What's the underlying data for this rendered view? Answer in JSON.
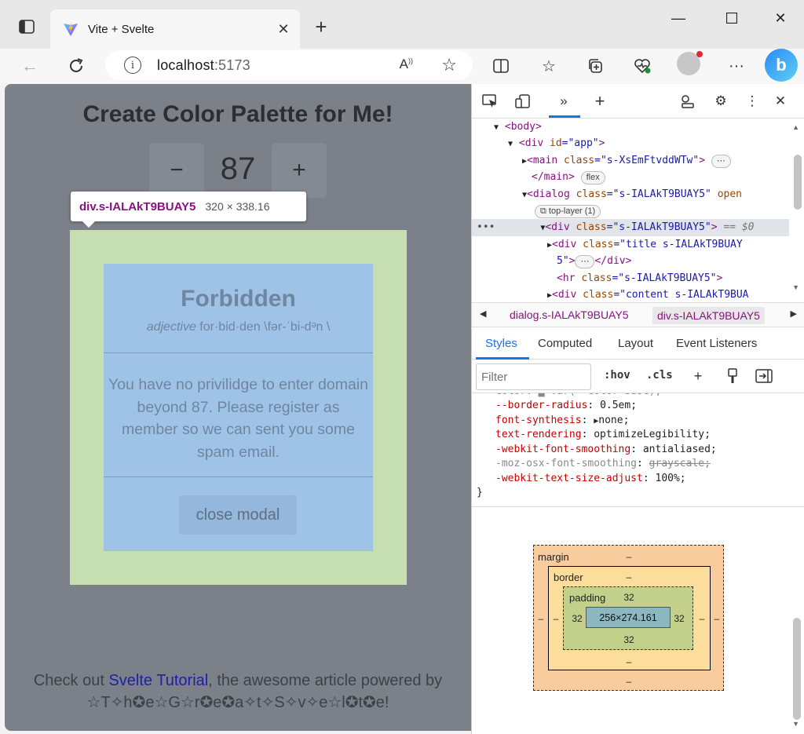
{
  "browser": {
    "tab_title": "Vite + Svelte",
    "url_host": "localhost",
    "url_port": ":5173"
  },
  "page": {
    "title": "Create Color Palette for Me!",
    "minus_label": "−",
    "counter_value": "87",
    "plus_label": "+",
    "inspect_tooltip": {
      "selector": "div.s-IALAkT9BUAY5",
      "dimensions": "320 × 338.16"
    },
    "modal": {
      "word": "Forbidden",
      "part_of_speech": "adjective",
      "pronunciation": "for·bid·den \\fər-ˈbi-dᵊn \\",
      "message": "You have no privilidge to enter domain beyond 87. Please register as member so we can sent you some spam email.",
      "close_label": "close modal"
    },
    "footer": {
      "prefix": "Check out ",
      "link": "Svelte Tutorial",
      "suffix": ", the awesome article powered by",
      "signature": "☆T✧h✪e☆G☆r✪e✪a✧t✧S✧v✧e☆l✪t✪e!"
    }
  },
  "devtools": {
    "dom_lines": [
      {
        "text": "body"
      },
      {
        "text": "div id=\"app\""
      },
      {
        "text": "main class=\"s-XsEmFtvddWTw\""
      },
      {
        "text": "/main"
      },
      {
        "text": "dialog class=\"s-IALAkT9BUAY5\" open"
      },
      {
        "text": "top-layer (1)"
      },
      {
        "text": "div class=\"s-IALAkT9BUAY5\" == $0"
      },
      {
        "text": "div class=\"title s-IALAkT9BUAY5\""
      },
      {
        "text": "hr class=\"s-IALAkT9BUAY5\""
      },
      {
        "text": "div class=\"content s-IALAkT9BUA"
      }
    ],
    "dom": {
      "body": "body",
      "div_app": "div",
      "id_attr": "id",
      "id_val": "\"app\"",
      "main_tag": "main",
      "class_attr": "class",
      "main_class": "\"s-XsEmFtvddWTw\"",
      "main_close": "/main",
      "flex_pill": "flex",
      "dialog_tag": "dialog",
      "dialog_class": "\"s-IALAkT9BUAY5\"",
      "open_attr": "open",
      "top_layer_pill": "top-layer (1)",
      "div_tag": "div",
      "div_class": "\"s-IALAkT9BUAY5\"",
      "eq0": "== $0",
      "title_class_1": "\"title s-IALAkT9BUAY",
      "title_class_2": "5\"",
      "hr_tag": "hr",
      "hr_class": "\"s-IALAkT9BUAY5\"",
      "content_class": "\"content s-IALAkT9BUA"
    },
    "breadcrumbs": [
      "dialog.s-IALAkT9BUAY5",
      "div.s-IALAkT9BUAY5"
    ],
    "subtabs": [
      "Styles",
      "Computed",
      "Layout",
      "Event Listeners"
    ],
    "filter_placeholder": "Filter",
    "hov_label": ":hov",
    "cls_label": ".cls",
    "styles": [
      {
        "prop": "--border-radius",
        "value": "0.5em;"
      },
      {
        "prop": "font-synthesis",
        "value": "none;"
      },
      {
        "prop": "text-rendering",
        "value": "optimizeLegibility;"
      },
      {
        "prop": "-webkit-font-smoothing",
        "value": "antialiased;"
      },
      {
        "prop": "-moz-osx-font-smoothing",
        "value": "grayscale;"
      },
      {
        "prop": "-webkit-text-size-adjust",
        "value": "100%;"
      }
    ],
    "close_brace": "}",
    "box_model": {
      "margin_label": "margin",
      "border_label": "border",
      "padding_label": "padding",
      "content": "256×274.161",
      "margin_top": "–",
      "margin_bottom": "–",
      "margin_left": "–",
      "margin_right": "–",
      "border_top": "–",
      "border_bottom": "–",
      "border_left": "–",
      "border_right": "–",
      "padding_top": "32",
      "padding_bottom": "32",
      "padding_left": "32",
      "padding_right": "32"
    }
  },
  "icons": {
    "tab_actions": "tab-actions-icon",
    "favicon": "vite-logo-icon",
    "back": "back-arrow-icon",
    "refresh": "refresh-icon",
    "info": "info-icon",
    "read_aloud": "read-aloud-icon",
    "favorite": "star-icon",
    "bing": "bing-copilot-icon"
  },
  "colors": {
    "overlay": "#7c8189",
    "modal_margin": "#c6dfb2",
    "modal_content": "#9fc3e7",
    "devtools_accent": "#1a73e8",
    "tag_color": "#881280"
  }
}
